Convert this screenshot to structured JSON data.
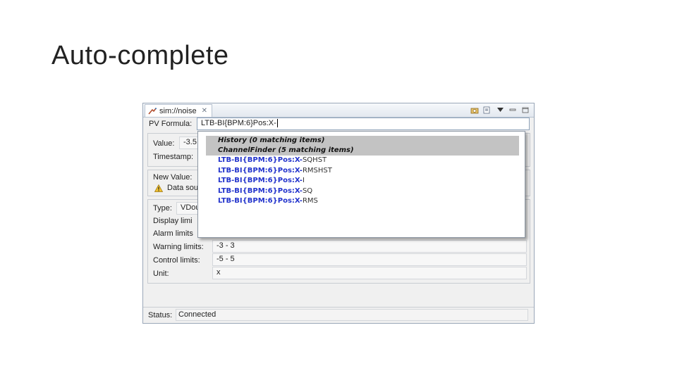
{
  "slide": {
    "title": "Auto-complete"
  },
  "window": {
    "tab_title": "sim://noise",
    "tab_icon": "probe-icon",
    "close_glyph": "✕",
    "tools": [
      "camera-icon",
      "snapshot-icon",
      "view-menu-icon",
      "minimize-icon",
      "maximize-icon"
    ]
  },
  "pv": {
    "label": "PV Formula:",
    "value": "LTB-BI{BPM:6}Pos:X-"
  },
  "value_group": {
    "value_label": "Value:",
    "value_text": "-3.5",
    "timestamp_label": "Timestamp:"
  },
  "new_value_group": {
    "new_value_label": "New Value:",
    "datasource_text": "Data sou"
  },
  "meta_group": {
    "type_label": "Type:",
    "type_value": "VDou",
    "display_limits_label": "Display limi",
    "alarm_limits_label": "Alarm limits",
    "warning_limits_label": "Warning limits:",
    "warning_limits_value": "-3 - 3",
    "control_limits_label": "Control limits:",
    "control_limits_value": "-5 - 5",
    "unit_label": "Unit:",
    "unit_value": "x"
  },
  "autocomplete": {
    "headers": [
      "History (0 matching items)",
      "ChannelFinder (5 matching items)"
    ],
    "match_prefix": "LTB-BI{BPM:6}Pos:X-",
    "items": [
      {
        "match": "LTB-BI{BPM:6}Pos:X-",
        "rest": "SQHST"
      },
      {
        "match": "LTB-BI{BPM:6}Pos:X-",
        "rest": "RMSHST"
      },
      {
        "match": "LTB-BI{BPM:6}Pos:X-",
        "rest": "I"
      },
      {
        "match": "LTB-BI{BPM:6}Pos:X-",
        "rest": "SQ"
      },
      {
        "match": "LTB-BI{BPM:6}Pos:X-",
        "rest": "RMS"
      }
    ]
  },
  "status": {
    "label": "Status:",
    "value": "Connected"
  }
}
